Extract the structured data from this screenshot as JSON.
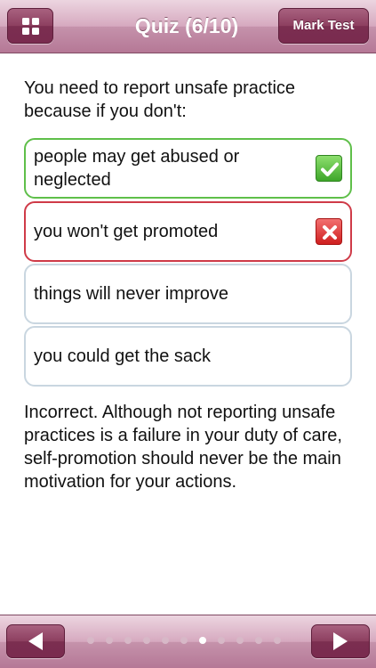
{
  "header": {
    "title": "Quiz (6/10)",
    "mark_button_label": "Mark Test",
    "menu_icon": "grid-icon"
  },
  "question": {
    "text": "You need to report unsafe practice because if you don't:"
  },
  "answers": [
    {
      "label": "people may get abused or neglected",
      "status": "correct",
      "icon": "check-icon"
    },
    {
      "label": "you won't get promoted",
      "status": "selected-wrong",
      "icon": "cross-icon"
    },
    {
      "label": "things will never improve",
      "status": "none"
    },
    {
      "label": "you could get the sack",
      "status": "none"
    }
  ],
  "feedback": {
    "text": "Incorrect. Although not reporting unsafe practices is a failure in your duty of care, self-promotion should never be the main motivation for your actions."
  },
  "pagination": {
    "total": 11,
    "current_index": 6
  },
  "colors": {
    "accent": "#7b2e50",
    "bar": "#c592ab",
    "correct": "#5fbf4a",
    "wrong": "#cf3b48",
    "neutral_border": "#c9d6e0"
  }
}
